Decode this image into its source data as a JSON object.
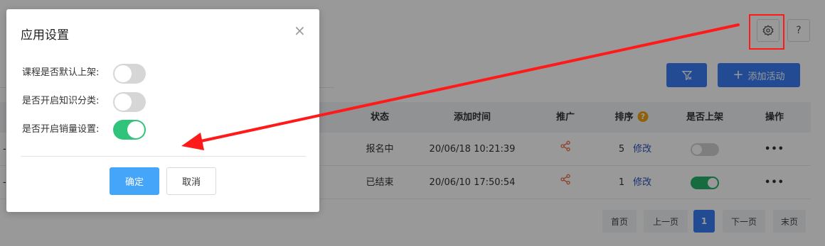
{
  "toolbar": {
    "settings_icon": "gear-icon",
    "help_label": "?",
    "add_label": "添加活动"
  },
  "table": {
    "columns": {
      "status": "状态",
      "added_time": "添加时间",
      "promote": "推广",
      "sort": "排序",
      "on_shelf": "是否上架",
      "actions": "操作"
    },
    "sort_help": "?",
    "rows": [
      {
        "dash": "-",
        "status": "报名中",
        "time": "20/06/18 10:21:39",
        "sort": "5",
        "edit": "修改",
        "on_shelf": false,
        "more": "•••"
      },
      {
        "dash": "-",
        "status": "已结束",
        "time": "20/06/10 17:50:54",
        "sort": "1",
        "edit": "修改",
        "on_shelf": true,
        "more": "•••"
      }
    ]
  },
  "pagination": {
    "first": "首页",
    "prev": "上一页",
    "current": "1",
    "next": "下一页",
    "last": "末页"
  },
  "dialog": {
    "title": "应用设置",
    "close": "×",
    "options": [
      {
        "label": "课程是否默认上架:",
        "enabled": false
      },
      {
        "label": "是否开启知识分类:",
        "enabled": false
      },
      {
        "label": "是否开启销量设置:",
        "enabled": true
      }
    ],
    "ok_label": "确定",
    "cancel_label": "取消"
  },
  "colors": {
    "primary": "#3b7df7",
    "switch_on": "#2fc479",
    "switch_off": "#d6d6d6",
    "ok_button": "#45a5f9",
    "annotation": "#ff1a1a"
  }
}
